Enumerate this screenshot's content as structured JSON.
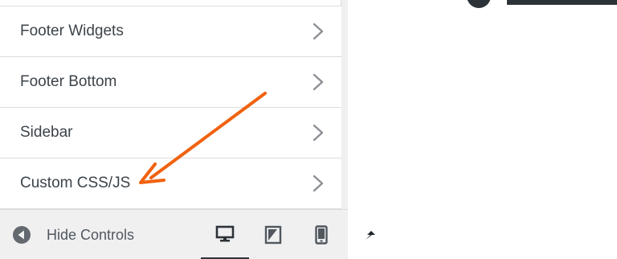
{
  "menu": {
    "items": [
      {
        "label": "Footer Widgets",
        "icon": "chevron-right-icon"
      },
      {
        "label": "Footer Bottom",
        "icon": "chevron-right-icon"
      },
      {
        "label": "Sidebar",
        "icon": "chevron-right-icon"
      },
      {
        "label": "Custom CSS/JS",
        "icon": "chevron-right-icon"
      }
    ]
  },
  "footer": {
    "hide_controls_label": "Hide Controls",
    "devices": [
      {
        "name": "desktop",
        "active": true
      },
      {
        "name": "tablet",
        "active": false
      },
      {
        "name": "mobile",
        "active": false
      }
    ]
  },
  "colors": {
    "arrow": "#f0620f",
    "text": "#3c434a",
    "panel_bg": "#ffffff",
    "bar_bg": "#f0f0f1",
    "dark": "#2c3338"
  }
}
